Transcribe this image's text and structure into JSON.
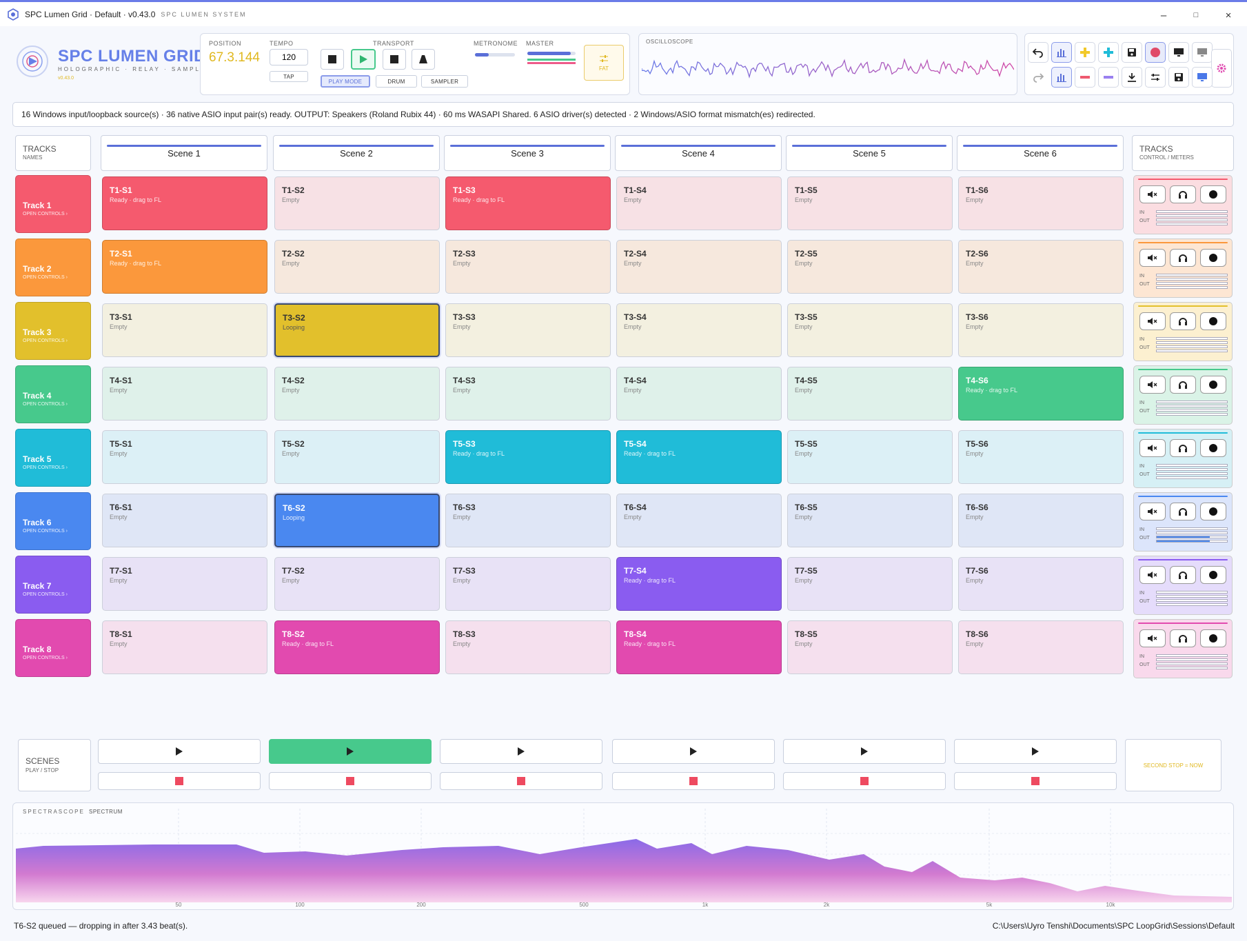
{
  "window": {
    "title": "SPC Lumen Grid · Default · v0.43.0",
    "subtitle": "SPC LUMEN SYSTEM",
    "minimize": "–",
    "maximize": "□",
    "close": "×"
  },
  "logo": {
    "title": "SPC LUMEN GRID",
    "subtitle": "HOLOGRAPHIC · RELAY · SAMPLER",
    "version": "v0.43.0"
  },
  "transport": {
    "position_label": "POSITION",
    "position_value": "67.3.144",
    "tempo_label": "TEMPO",
    "tempo_value": "120",
    "tap_label": "TAP",
    "transport_label": "TRANSPORT",
    "play_mode_label": "PLAY MODE",
    "drum_label": "DRUM",
    "sampler_label": "SAMPLER",
    "metronome_label": "METRONOME",
    "master_label": "MASTER",
    "fat_label": "FAT",
    "metronome_level": 0.35,
    "master_level": 0.9
  },
  "oscilloscope": {
    "label": "OSCILLOSCOPE"
  },
  "status_bar": "16 Windows input/loopback source(s) · 36 native ASIO input pair(s) ready. OUTPUT: Speakers (Roland Rubix 44) · 60 ms WASAPI Shared. 6 ASIO driver(s) detected · 2 Windows/ASIO format mismatch(es) redirected.",
  "tracks_header": {
    "title": "TRACKS",
    "sub": "NAMES"
  },
  "controls_header": {
    "title": "TRACKS",
    "sub": "CONTROL / METERS"
  },
  "scenes": [
    "Scene 1",
    "Scene 2",
    "Scene 3",
    "Scene 4",
    "Scene 5",
    "Scene 6"
  ],
  "tracks": [
    {
      "name": "Track 1",
      "sub": "OPEN CONTROLS ›",
      "color": "#f55a6e",
      "tint": "#f7e1e5",
      "ctrl_bg": "#fbdde1"
    },
    {
      "name": "Track 2",
      "sub": "OPEN CONTROLS ›",
      "color": "#fb983c",
      "tint": "#f6e8dd",
      "ctrl_bg": "#fde6d3"
    },
    {
      "name": "Track 3",
      "sub": "OPEN CONTROLS ›",
      "color": "#e2c02c",
      "tint": "#f3f0e0",
      "ctrl_bg": "#fcf0d0"
    },
    {
      "name": "Track 4",
      "sub": "OPEN CONTROLS ›",
      "color": "#47c98c",
      "tint": "#dff1ea",
      "ctrl_bg": "#daf3e7"
    },
    {
      "name": "Track 5",
      "sub": "OPEN CONTROLS ›",
      "color": "#20bcd8",
      "tint": "#dcf0f6",
      "ctrl_bg": "#d6f0f5"
    },
    {
      "name": "Track 6",
      "sub": "OPEN CONTROLS ›",
      "color": "#4a88f0",
      "tint": "#dfe6f6",
      "ctrl_bg": "#dce5fb"
    },
    {
      "name": "Track 7",
      "sub": "OPEN CONTROLS ›",
      "color": "#8a5cf0",
      "tint": "#e8e2f6",
      "ctrl_bg": "#e5dcfb"
    },
    {
      "name": "Track 8",
      "sub": "OPEN CONTROLS ›",
      "color": "#e24aaf",
      "tint": "#f5e0ee",
      "ctrl_bg": "#f9d9ec"
    }
  ],
  "clips": [
    [
      {
        "name": "T1-S1",
        "state": "Ready · drag to FL",
        "full": true
      },
      {
        "name": "T1-S2",
        "state": "Empty"
      },
      {
        "name": "T1-S3",
        "state": "Ready · drag to FL",
        "full": true
      },
      {
        "name": "T1-S4",
        "state": "Empty"
      },
      {
        "name": "T1-S5",
        "state": "Empty"
      },
      {
        "name": "T1-S6",
        "state": "Empty"
      }
    ],
    [
      {
        "name": "T2-S1",
        "state": "Ready · drag to FL",
        "full": true
      },
      {
        "name": "T2-S2",
        "state": "Empty"
      },
      {
        "name": "T2-S3",
        "state": "Empty"
      },
      {
        "name": "T2-S4",
        "state": "Empty"
      },
      {
        "name": "T2-S5",
        "state": "Empty"
      },
      {
        "name": "T2-S6",
        "state": "Empty"
      }
    ],
    [
      {
        "name": "T3-S1",
        "state": "Empty"
      },
      {
        "name": "T3-S2",
        "state": "Looping",
        "full": true,
        "loop": true
      },
      {
        "name": "T3-S3",
        "state": "Empty"
      },
      {
        "name": "T3-S4",
        "state": "Empty"
      },
      {
        "name": "T3-S5",
        "state": "Empty"
      },
      {
        "name": "T3-S6",
        "state": "Empty"
      }
    ],
    [
      {
        "name": "T4-S1",
        "state": "Empty"
      },
      {
        "name": "T4-S2",
        "state": "Empty"
      },
      {
        "name": "T4-S3",
        "state": "Empty"
      },
      {
        "name": "T4-S4",
        "state": "Empty"
      },
      {
        "name": "T4-S5",
        "state": "Empty"
      },
      {
        "name": "T4-S6",
        "state": "Ready · drag to FL",
        "full": true
      }
    ],
    [
      {
        "name": "T5-S1",
        "state": "Empty"
      },
      {
        "name": "T5-S2",
        "state": "Empty"
      },
      {
        "name": "T5-S3",
        "state": "Ready · drag to FL",
        "full": true
      },
      {
        "name": "T5-S4",
        "state": "Ready · drag to FL",
        "full": true
      },
      {
        "name": "T5-S5",
        "state": "Empty"
      },
      {
        "name": "T5-S6",
        "state": "Empty"
      }
    ],
    [
      {
        "name": "T6-S1",
        "state": "Empty"
      },
      {
        "name": "T6-S2",
        "state": "Looping",
        "full": true,
        "loop": true
      },
      {
        "name": "T6-S3",
        "state": "Empty"
      },
      {
        "name": "T6-S4",
        "state": "Empty"
      },
      {
        "name": "T6-S5",
        "state": "Empty"
      },
      {
        "name": "T6-S6",
        "state": "Empty"
      }
    ],
    [
      {
        "name": "T7-S1",
        "state": "Empty"
      },
      {
        "name": "T7-S2",
        "state": "Empty"
      },
      {
        "name": "T7-S3",
        "state": "Empty"
      },
      {
        "name": "T7-S4",
        "state": "Ready · drag to FL",
        "full": true
      },
      {
        "name": "T7-S5",
        "state": "Empty"
      },
      {
        "name": "T7-S6",
        "state": "Empty"
      }
    ],
    [
      {
        "name": "T8-S1",
        "state": "Empty"
      },
      {
        "name": "T8-S2",
        "state": "Ready · drag to FL",
        "full": true
      },
      {
        "name": "T8-S3",
        "state": "Empty"
      },
      {
        "name": "T8-S4",
        "state": "Ready · drag to FL",
        "full": true
      },
      {
        "name": "T8-S5",
        "state": "Empty"
      },
      {
        "name": "T8-S6",
        "state": "Empty"
      }
    ]
  ],
  "track_controls": {
    "in_label": "IN",
    "out_label": "OUT",
    "mute_icon": "mute-icon",
    "headphones_icon": "headphones-icon",
    "record_icon": "record-icon",
    "out_levels": [
      0,
      0,
      0,
      0,
      0,
      0.75,
      0,
      0
    ]
  },
  "scene_launch": {
    "title": "SCENES",
    "sub": "PLAY / STOP",
    "active_scene": 1,
    "active_color": "#47c98c",
    "stop_color": "#ee4a60",
    "second_stop": "SECOND STOP = NOW"
  },
  "spectrum": {
    "label": "SPECTRASCOPE",
    "sub": "SPECTRUM",
    "freq_ticks": [
      "50",
      "100",
      "200",
      "500",
      "1k",
      "2k",
      "5k",
      "10k"
    ]
  },
  "footer": {
    "message": "T6-S2 queued — dropping in after 3.43 beat(s).",
    "path": "C:\\Users\\Uyro Tenshi\\Documents\\SPC LoopGrid\\Sessions\\Default"
  },
  "toolbar_icons": [
    "undo-icon",
    "bars-icon",
    "add-yellow-icon",
    "add-cyan-icon",
    "save-icon",
    "record-icon",
    "monitor-icon",
    "monitor-grey-icon",
    "settings-gear-icon",
    "redo-icon",
    "bars-active-icon",
    "remove-red-icon",
    "remove-purple-icon",
    "download-icon",
    "mixer-icon",
    "save-as-icon",
    "display-icon"
  ],
  "colors": {
    "accent": "#5a6fd8",
    "brand": "#6680e8",
    "gold": "#e0b820",
    "play_green": "#47c98c"
  }
}
